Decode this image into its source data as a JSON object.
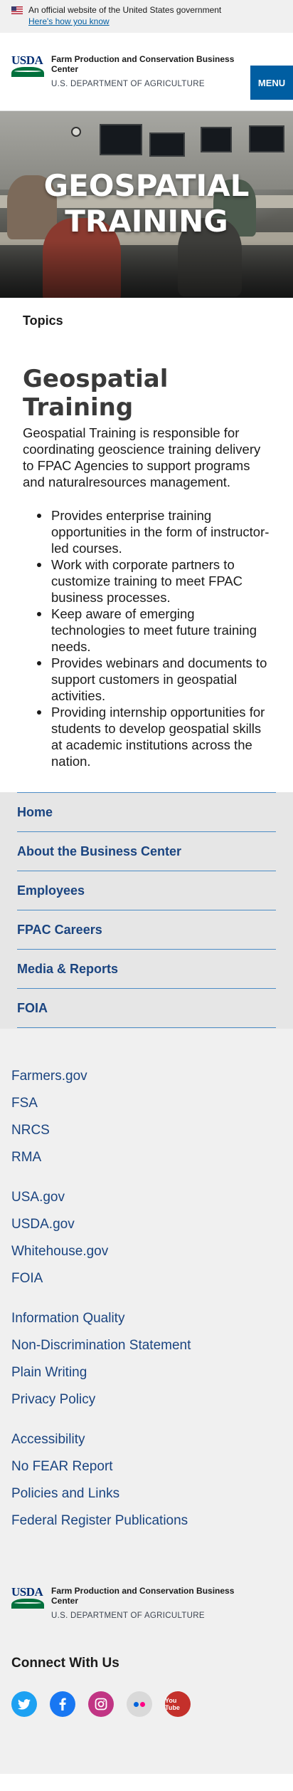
{
  "gov_banner": {
    "official_text": "An official website of the United States government",
    "how_link": "Here's how you know"
  },
  "header": {
    "logo_text": "USDA",
    "agency_name": "Farm Production and Conservation Business Center",
    "department": "U.S. DEPARTMENT OF AGRICULTURE",
    "menu_label": "MENU"
  },
  "hero": {
    "title": "GEOSPATIAL TRAINING"
  },
  "main": {
    "breadcrumb": "Topics",
    "title": "Geospatial Training",
    "intro": "Geospatial Training is responsible for coordinating geoscience training delivery to FPAC Agencies to support programs and naturalresources management.",
    "bullets": [
      "Provides enterprise training opportunities in the form of instructor-led courses.",
      "Work with corporate partners to customize training to meet FPAC business processes.",
      "Keep aware of emerging technologies to meet future training needs.",
      "Provides webinars and documents to support customers in geospatial activities.",
      "Providing internship opportunities for students to develop geospatial skills at academic institutions across the nation."
    ]
  },
  "side_nav": {
    "items": [
      "Home",
      "About the Business Center",
      "Employees",
      "FPAC Careers",
      "Media & Reports",
      "FOIA"
    ]
  },
  "footer": {
    "groups": [
      [
        "Farmers.gov",
        "FSA",
        "NRCS",
        "RMA"
      ],
      [
        "USA.gov",
        "USDA.gov",
        "Whitehouse.gov",
        "FOIA"
      ],
      [
        "Information Quality",
        "Non-Discrimination Statement",
        "Plain Writing",
        "Privacy Policy"
      ],
      [
        "Accessibility",
        "No FEAR Report",
        "Policies and Links",
        "Federal Register Publications"
      ]
    ],
    "logo_text": "USDA",
    "agency_name": "Farm Production and Conservation Business Center",
    "department": "U.S. DEPARTMENT OF AGRICULTURE",
    "connect_heading": "Connect With Us",
    "social": [
      "twitter-icon",
      "facebook-icon",
      "instagram-icon",
      "flickr-icon",
      "youtube-icon"
    ],
    "youtube_text": "You Tube"
  },
  "colors": {
    "link": "#1a4480",
    "menu_button": "#005ea2",
    "nav_divider": "#4c8cc5"
  }
}
